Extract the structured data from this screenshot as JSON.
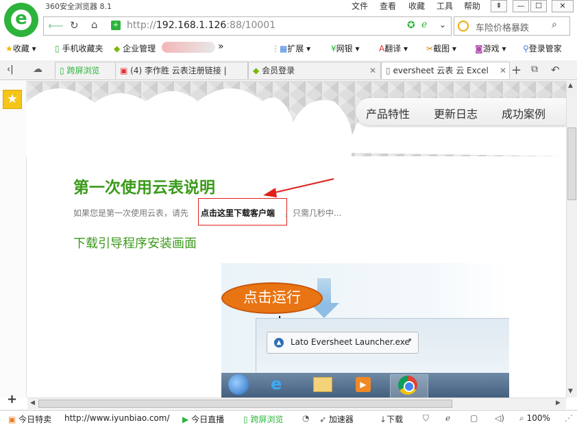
{
  "app": {
    "title": "360安全浏览器 8.1"
  },
  "menu": [
    "文件",
    "查看",
    "收藏",
    "工具",
    "帮助"
  ],
  "address": {
    "protocol": "http://",
    "host": "192.168.1.126",
    "port_path": ":88/10001"
  },
  "search": {
    "placeholder": "车险价格暴跌"
  },
  "bookmarks": {
    "favorites": "收藏",
    "mobile": "手机收藏夹",
    "enterprise": "企业管理",
    "ext": "扩展",
    "bank": "网银",
    "translate": "翻译",
    "screenshot": "截图",
    "games": "游戏",
    "login": "登录管家"
  },
  "tabs": [
    {
      "label": "跨屏浏览"
    },
    {
      "label": "(4) 李作胜 云表注册链接 |"
    },
    {
      "label": "会员登录"
    },
    {
      "label": "eversheet 云表 云 Excel"
    }
  ],
  "page": {
    "nav": [
      "产品特性",
      "更新日志",
      "成功案例"
    ],
    "heading": "第一次使用云表说明",
    "intro_before": "如果您是第一次使用云表，请先",
    "download_link": "点击这里下载客户端",
    "intro_after": "，只需几秒中...",
    "subheading": "下载引导程序安装画面",
    "callout": "点击运行",
    "launcher": "Lato Eversheet Launcher.exe"
  },
  "status": {
    "today_deal": "今日特卖",
    "url": "http://www.iyunbiao.com/",
    "live": "今日直播",
    "cross_screen": "跨屏浏览",
    "accelerator": "加速器",
    "download": "下载",
    "zoom": "100%"
  },
  "colors": {
    "brand_green": "#2db33c",
    "heading_green": "#3a9a1a",
    "link_red": "#e0201c"
  }
}
